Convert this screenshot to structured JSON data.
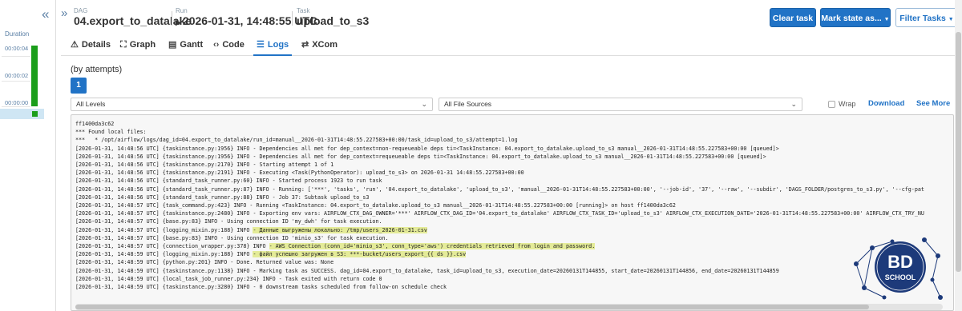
{
  "gantt": {
    "duration_label": "Duration",
    "ticks": [
      "00:00:04",
      "00:00:02",
      "00:00:00"
    ]
  },
  "header": {
    "dag_label": "DAG",
    "dag_value": "04.export_to_datalake",
    "run_label": "Run",
    "run_value": "2026-01-31, 14:48:55 UTC",
    "task_label": "Task",
    "task_value": "upload_to_s3",
    "clear_task": "Clear task",
    "mark_state": "Mark state as...",
    "filter_tasks": "Filter Tasks"
  },
  "tabs": [
    {
      "label": "Details",
      "icon": "warning-icon"
    },
    {
      "label": "Graph",
      "icon": "graph-icon"
    },
    {
      "label": "Gantt",
      "icon": "gantt-icon"
    },
    {
      "label": "Code",
      "icon": "code-icon"
    },
    {
      "label": "Logs",
      "icon": "list-icon",
      "active": true
    },
    {
      "label": "XCom",
      "icon": "exchange-icon"
    }
  ],
  "attempts": {
    "label": "(by attempts)",
    "current": "1"
  },
  "filters": {
    "levels": "All Levels",
    "sources": "All File Sources",
    "wrap": "Wrap",
    "download": "Download",
    "see_more": "See More"
  },
  "log_lines": [
    "ff1400da3c62",
    "*** Found local files:",
    "***   * /opt/airflow/logs/dag_id=04.export_to_datalake/run_id=manual__2026-01-31T14:48:55.227583+00:00/task_id=upload_to_s3/attempt=1.log",
    "[2026-01-31, 14:48:56 UTC] {taskinstance.py:1956} INFO - Dependencies all met for dep_context=non-requeueable deps ti=<TaskInstance: 04.export_to_datalake.upload_to_s3 manual__2026-01-31T14:48:55.227583+00:00 [queued]>",
    "[2026-01-31, 14:48:56 UTC] {taskinstance.py:1956} INFO - Dependencies all met for dep_context=requeueable deps ti=<TaskInstance: 04.export_to_datalake.upload_to_s3 manual__2026-01-31T14:48:55.227583+00:00 [queued]>",
    "[2026-01-31, 14:48:56 UTC] {taskinstance.py:2170} INFO - Starting attempt 1 of 1",
    "[2026-01-31, 14:48:56 UTC] {taskinstance.py:2191} INFO - Executing <Task(PythonOperator): upload_to_s3> on 2026-01-31 14:48:55.227583+00:00",
    "[2026-01-31, 14:48:56 UTC] {standard_task_runner.py:60} INFO - Started process 1923 to run task",
    "[2026-01-31, 14:48:56 UTC] {standard_task_runner.py:87} INFO - Running: ['***', 'tasks', 'run', '04.export_to_datalake', 'upload_to_s3', 'manual__2026-01-31T14:48:55.227583+00:00', '--job-id', '37', '--raw', '--subdir', 'DAGS_FOLDER/postgres_to_s3.py', '--cfg-pat",
    "[2026-01-31, 14:48:56 UTC] {standard_task_runner.py:88} INFO - Job 37: Subtask upload_to_s3",
    "[2026-01-31, 14:48:57 UTC] {task_command.py:423} INFO - Running <TaskInstance: 04.export_to_datalake.upload_to_s3 manual__2026-01-31T14:48:55.227583+00:00 [running]> on host ff1400da3c62",
    "[2026-01-31, 14:48:57 UTC] {taskinstance.py:2480} INFO - Exporting env vars: AIRFLOW_CTX_DAG_OWNER='***' AIRFLOW_CTX_DAG_ID='04.export_to_datalake' AIRFLOW_CTX_TASK_ID='upload_to_s3' AIRFLOW_CTX_EXECUTION_DATE='2026-01-31T14:48:55.227583+00:00' AIRFLOW_CTX_TRY_NU",
    "[2026-01-31, 14:48:57 UTC] {base.py:83} INFO - Using connection ID 'my_dwh' for task execution.",
    {
      "prefix": "[2026-01-31, 14:48:57 UTC] {logging_mixin.py:188} INFO ",
      "highlight": "- Данные выгружены локально: /tmp/users_2026-01-31.csv"
    },
    "[2026-01-31, 14:48:57 UTC] {base.py:83} INFO - Using connection ID 'minio_s3' for task execution.",
    {
      "prefix": "[2026-01-31, 14:48:57 UTC] {connection_wrapper.py:378} INFO ",
      "highlight": "- AWS Connection (conn_id='minio_s3', conn_type='aws') credentials retrieved from login and password."
    },
    {
      "prefix": "[2026-01-31, 14:48:59 UTC] {logging_mixin.py:188} INFO ",
      "highlight": "- файл успешно загружен в S3: ***-bucket/users_export_{{ ds }}.csv"
    },
    "[2026-01-31, 14:48:59 UTC] {python.py:201} INFO - Done. Returned value was: None",
    "[2026-01-31, 14:48:59 UTC] {taskinstance.py:1138} INFO - Marking task as SUCCESS. dag_id=04.export_to_datalake, task_id=upload_to_s3, execution_date=20260131T144855, start_date=20260131T144856, end_date=20260131T144859",
    "[2026-01-31, 14:48:59 UTC] {local_task_job_runner.py:234} INFO - Task exited with return code 0",
    "[2026-01-31, 14:48:59 UTC] {taskinstance.py:3280} INFO - 0 downstream tasks scheduled from follow-on schedule check"
  ],
  "watermark": {
    "line1": "BD",
    "line2": "SCHOOL"
  },
  "colors": {
    "primary": "#2173c6",
    "success": "#1b9e1b",
    "highlight": "#e4eb98"
  }
}
